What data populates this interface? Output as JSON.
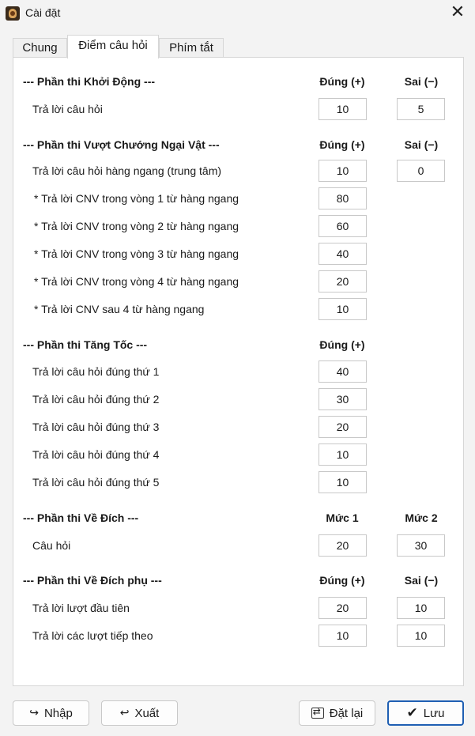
{
  "window": {
    "title": "Cài đặt",
    "close": "✕"
  },
  "tabs": [
    "Chung",
    "Điểm câu hỏi",
    "Phím tắt"
  ],
  "sections": {
    "khoi_dong": {
      "title": "--- Phần thi Khởi Động ---",
      "col1": "Đúng (+)",
      "col2": "Sai (−)",
      "rows": [
        {
          "label": "Trả lời câu hỏi",
          "v1": "10",
          "v2": "5"
        }
      ]
    },
    "vcnv": {
      "title": "--- Phần thi Vượt Chướng Ngại Vật ---",
      "col1": "Đúng (+)",
      "col2": "Sai (−)",
      "rows": [
        {
          "label": "Trả lời câu hỏi hàng ngang (trung tâm)",
          "v1": "10",
          "v2": "0"
        },
        {
          "label": "* Trả lời CNV trong vòng 1 từ hàng ngang",
          "v1": "80"
        },
        {
          "label": "* Trả lời CNV trong vòng 2 từ hàng ngang",
          "v1": "60"
        },
        {
          "label": "* Trả lời CNV trong vòng 3 từ hàng ngang",
          "v1": "40"
        },
        {
          "label": "* Trả lời CNV trong vòng 4 từ hàng ngang",
          "v1": "20"
        },
        {
          "label": "* Trả lời CNV sau 4 từ hàng ngang",
          "v1": "10"
        }
      ]
    },
    "tang_toc": {
      "title": "--- Phần thi Tăng Tốc ---",
      "col1": "Đúng (+)",
      "rows": [
        {
          "label": "Trả lời câu hỏi đúng thứ 1",
          "v1": "40"
        },
        {
          "label": "Trả lời câu hỏi đúng thứ 2",
          "v1": "30"
        },
        {
          "label": "Trả lời câu hỏi đúng thứ 3",
          "v1": "20"
        },
        {
          "label": "Trả lời câu hỏi đúng thứ 4",
          "v1": "10"
        },
        {
          "label": "Trả lời câu hỏi đúng thứ 5",
          "v1": "10"
        }
      ]
    },
    "ve_dich": {
      "title": "--- Phần thi Về Đích ---",
      "col1": "Mức 1",
      "col2": "Mức 2",
      "rows": [
        {
          "label": "Câu hỏi",
          "v1": "20",
          "v2": "30"
        }
      ]
    },
    "ve_dich_phu": {
      "title": "--- Phần thi Về Đích phụ ---",
      "col1": "Đúng (+)",
      "col2": "Sai (−)",
      "rows": [
        {
          "label": "Trả lời lượt đầu tiên",
          "v1": "20",
          "v2": "10"
        },
        {
          "label": "Trả lời các lượt tiếp theo",
          "v1": "10",
          "v2": "10"
        }
      ]
    }
  },
  "footer": {
    "import": "Nhập",
    "import_icon": "↪",
    "export": "Xuất",
    "export_icon": "↩",
    "reset": "Đặt lại",
    "save": "Lưu",
    "save_icon": "✔"
  }
}
